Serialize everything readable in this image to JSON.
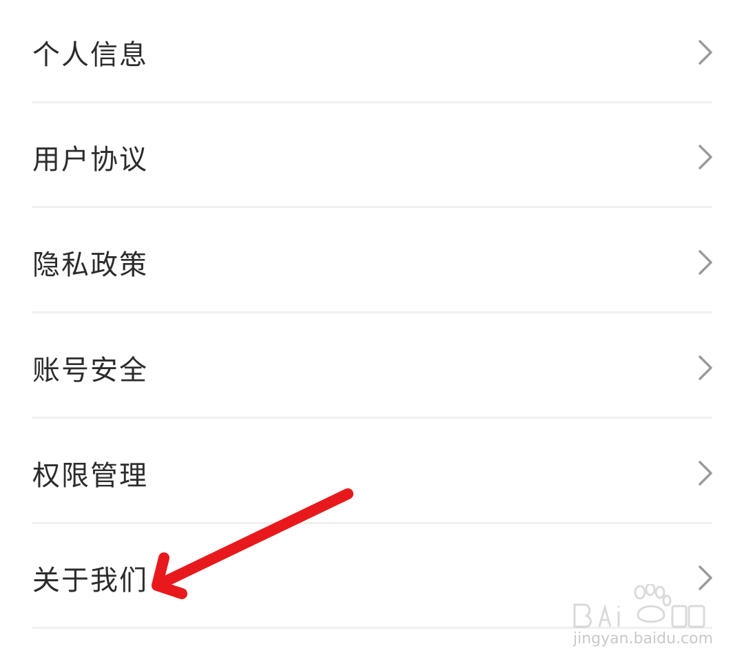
{
  "settings": {
    "items": [
      {
        "label": "个人信息",
        "icon": "chevron-right-icon"
      },
      {
        "label": "用户协议",
        "icon": "chevron-right-icon"
      },
      {
        "label": "隐私政策",
        "icon": "chevron-right-icon"
      },
      {
        "label": "账号安全",
        "icon": "chevron-right-icon"
      },
      {
        "label": "权限管理",
        "icon": "chevron-right-icon"
      },
      {
        "label": "关于我们",
        "icon": "chevron-right-icon"
      }
    ]
  },
  "annotation": {
    "icon": "red-arrow-icon",
    "color": "#e8191c"
  },
  "watermark": {
    "domain": "jingyan.baidu.com",
    "logo_label": "Bai du 经验"
  },
  "colors": {
    "text": "#2c2c2c",
    "chevron": "#9a9a9a",
    "divider": "#f0f0f0",
    "background": "#ffffff"
  }
}
